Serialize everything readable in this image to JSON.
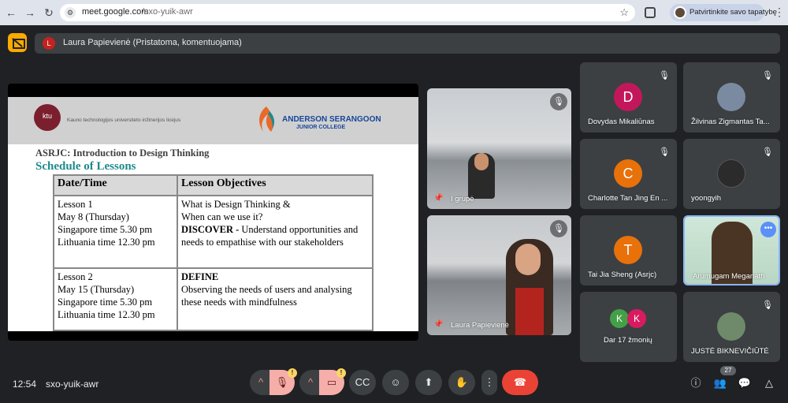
{
  "browser": {
    "url_host": "meet.google.com",
    "url_path": "/sxo-yuik-awr",
    "profile_label": "Patvirtinkite savo tapatybę"
  },
  "presenter": {
    "avatar_letter": "L",
    "text": "Laura Papievienė (Pristatoma, komentuojama)"
  },
  "slide": {
    "ktu_logo": "ktu",
    "ktu_text": "Kauno technologijos universiteto inžinerijos licėjus",
    "school_name": "ANDERSON SERANGOON",
    "school_sub": "JUNIOR COLLEGE",
    "subtitle": "ASRJC: Introduction to Design Thinking",
    "title": "Schedule of Lessons",
    "columns": [
      "Date/Time",
      "Lesson Objectives"
    ],
    "rows": [
      {
        "date_lines": [
          "Lesson 1",
          "May 8 (Thursday)",
          "Singapore time 5.30 pm",
          "Lithuania time 12.30 pm"
        ],
        "obj_line1": "What is Design Thinking &",
        "obj_line2": "When can we use it?",
        "obj_bold": "DISCOVER -",
        "obj_rest": " Understand opportunities and needs to empathise with our stakeholders"
      },
      {
        "date_lines": [
          "Lesson 2",
          "May 15 (Thursday)",
          "Singapore time 5.30 pm",
          "Lithuania time 12.30 pm"
        ],
        "obj_bold": "DEFINE",
        "obj_rest": "Observing the needs of users and analysing these needs with mindfulness"
      }
    ]
  },
  "video_tiles": [
    {
      "name": "I grupė"
    },
    {
      "name": "Laura Papievienė"
    }
  ],
  "participants": [
    {
      "name": "Dovydas Mikaliūnas",
      "letter": "D",
      "color": "#c2185b"
    },
    {
      "name": "Žilvinas Zigmantas Ta...",
      "letter": "",
      "color": "#7a8aa0"
    },
    {
      "name": "Charlotte Tan Jing En ...",
      "letter": "C",
      "color": "#e8710a"
    },
    {
      "name": "yoongyih",
      "letter": "",
      "color": "#2b2b2b"
    },
    {
      "name": "Tai Jia Sheng (Asrjc)",
      "letter": "T",
      "color": "#e8710a"
    },
    {
      "name": "Arumugam Meganath",
      "letter": "",
      "color": "#4a5a3a"
    },
    {
      "name": "Dar 17 žmonių",
      "letter": "",
      "color": ""
    },
    {
      "name": "JUSTĖ BIKNEVIČIŪTĖ",
      "letter": "",
      "color": "#6f8a6a"
    }
  ],
  "more_people": {
    "k1": "K",
    "k2": "K"
  },
  "toolbar": {
    "time": "12:54",
    "divider": "|",
    "meeting_code": "sxo-yuik-awr",
    "people_count": "27"
  }
}
